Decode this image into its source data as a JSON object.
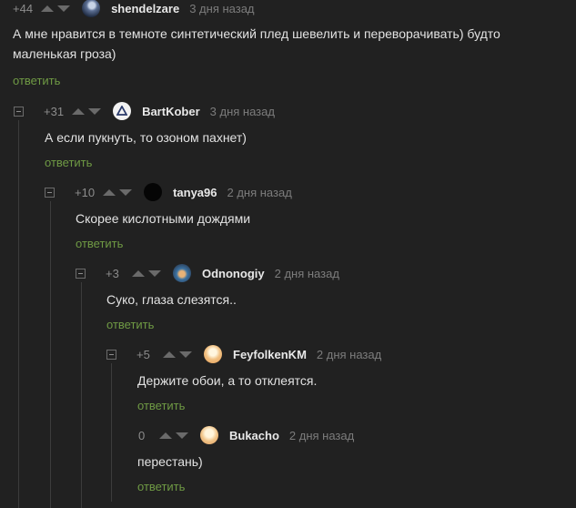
{
  "reply_label": "ответить",
  "comments": [
    {
      "rating": "+44",
      "username": "shendelzare",
      "time": "3 дня назад",
      "text_lines": [
        "А мне нравится в темноте синтетический плед шевелить и переворачивать) будто",
        "маленькая гроза)"
      ]
    },
    {
      "rating": "+31",
      "username": "BartKober",
      "time": "3 дня назад",
      "text_lines": [
        "А если пукнуть, то озоном пахнет)"
      ]
    },
    {
      "rating": "+10",
      "username": "tanya96",
      "time": "2 дня назад",
      "text_lines": [
        "Скорее кислотными дождями"
      ]
    },
    {
      "rating": "+3",
      "username": "Odnonogiy",
      "time": "2 дня назад",
      "text_lines": [
        "Суко, глаза слезятся.."
      ]
    },
    {
      "rating": "+5",
      "username": "FeyfolkenKM",
      "time": "2 дня назад",
      "text_lines": [
        "Держите обои, а то отклеятся."
      ]
    },
    {
      "rating": "0",
      "username": "Bukacho",
      "time": "2 дня назад",
      "text_lines": [
        "перестань)"
      ]
    }
  ],
  "colors": {
    "background": "#212121",
    "reply_link": "#6f9a44",
    "text": "#e2e2e2",
    "meta": "#7c7c7c"
  }
}
